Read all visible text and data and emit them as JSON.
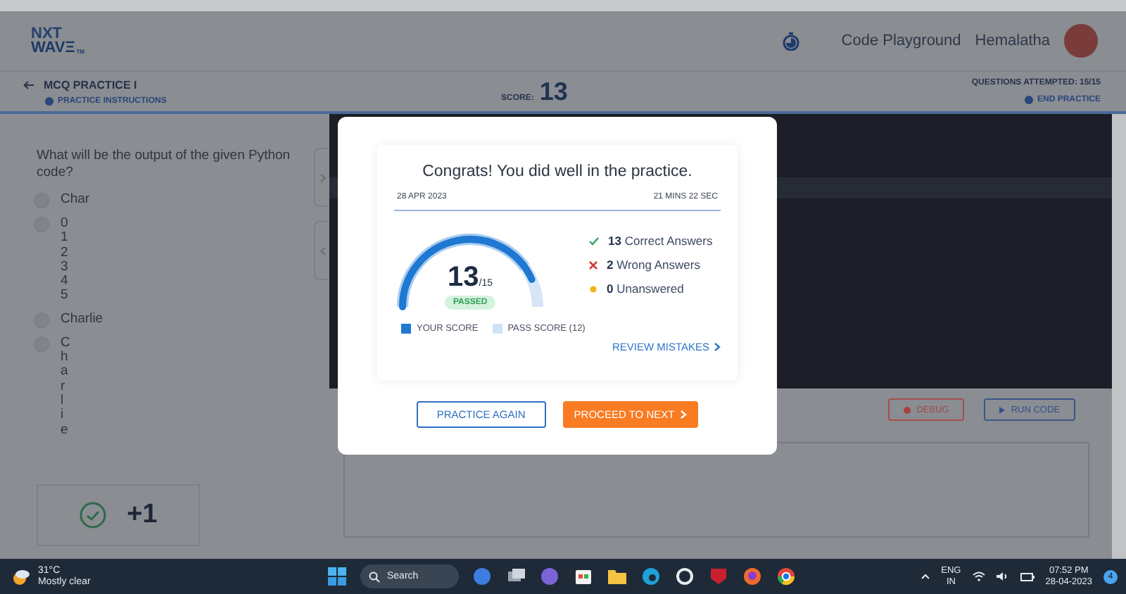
{
  "header": {
    "logo_top": "NXT",
    "logo_bottom": "WAVΞ",
    "logo_mark": "TM",
    "nav_link": "Code Playground",
    "user_name": "Hemalatha"
  },
  "subheader": {
    "title": "MCQ PRACTICE I",
    "instructions_link": "PRACTICE INSTRUCTIONS",
    "score_label": "SCORE:",
    "score": "13",
    "attempted": "QUESTIONS ATTEMPTED: 15/15",
    "end_link": "END PRACTICE"
  },
  "question": {
    "text": "What will be the output of the given Python code?",
    "options": [
      {
        "lines": [
          "Char"
        ],
        "selected": false
      },
      {
        "lines": [
          "0",
          "1",
          "2",
          "3",
          "4",
          "5"
        ],
        "selected": false
      },
      {
        "lines": [
          "Charlie"
        ],
        "selected": false
      },
      {
        "lines": [
          "C",
          "h",
          "a",
          "r",
          "l",
          "i",
          "e"
        ],
        "selected": false
      }
    ],
    "feedback": "+1"
  },
  "editor": {
    "buttons": [
      {
        "kind": "debug",
        "label": "DEBUG"
      },
      {
        "kind": "run",
        "label": "RUN CODE"
      }
    ]
  },
  "modal": {
    "title": "Congrats! You did well in the practice.",
    "date": "28 APR 2023",
    "duration": "21 MINS 22 SEC",
    "gauge": {
      "level": 0.8667,
      "score": "13",
      "total": "/15",
      "status": "PASSED",
      "pass": {
        "level": 0.8
      }
    },
    "stats": [
      {
        "kind": "correct",
        "count": "13",
        "label": "Correct Answers"
      },
      {
        "kind": "wrong",
        "count": "2",
        "label": "Wrong Answers"
      },
      {
        "kind": "unanswered",
        "count": "0",
        "label": "Unanswered"
      }
    ],
    "legend": [
      "YOUR SCORE",
      "PASS SCORE (12)"
    ],
    "review_link": "REVIEW MISTAKES",
    "buttons": [
      {
        "kind": "outline",
        "label": "PRACTICE AGAIN"
      },
      {
        "kind": "primary",
        "label": "PROCEED TO NEXT"
      }
    ]
  },
  "taskbar": {
    "temperature": "31°C",
    "weather": "Mostly clear",
    "search_placeholder": "Search",
    "language": "ENG",
    "region": "IN",
    "time": "07:52 PM",
    "date": "28-04-2023",
    "notifications": "4"
  }
}
